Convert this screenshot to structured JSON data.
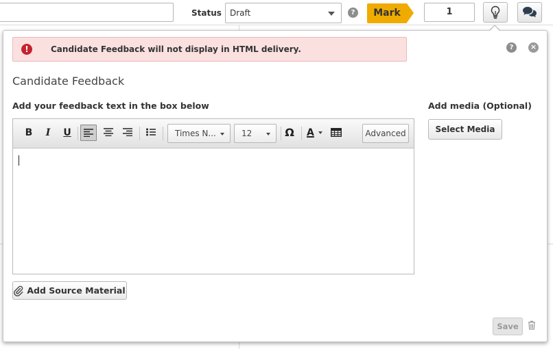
{
  "header": {
    "status_label": "Status :",
    "status_value": "Draft",
    "help_symbol": "?",
    "mark_label": "Mark",
    "mark_value": "1",
    "icons": [
      "lightbulb-icon",
      "speech-bubbles-icon"
    ]
  },
  "panel": {
    "alert": {
      "symbol": "!",
      "text": "Candidate Feedback will not display in HTML delivery."
    },
    "help_symbol": "?",
    "close_symbol": "×",
    "title": "Candidate Feedback",
    "feedback_label": "Add your feedback text in the box below",
    "media_label": "Add media (Optional)",
    "select_media_label": "Select Media",
    "add_source_label": "Add Source Material",
    "save_label": "Save"
  },
  "editor": {
    "bold": "B",
    "italic": "I",
    "underline": "U",
    "font_family": "Times N...",
    "font_size": "12",
    "special_char": "Ω",
    "text_color": "A",
    "advanced_label": "Advanced"
  },
  "colors": {
    "mark_accent": "#f0ab00",
    "alert_background": "#fbe0e0",
    "alert_icon": "#c5232f"
  }
}
